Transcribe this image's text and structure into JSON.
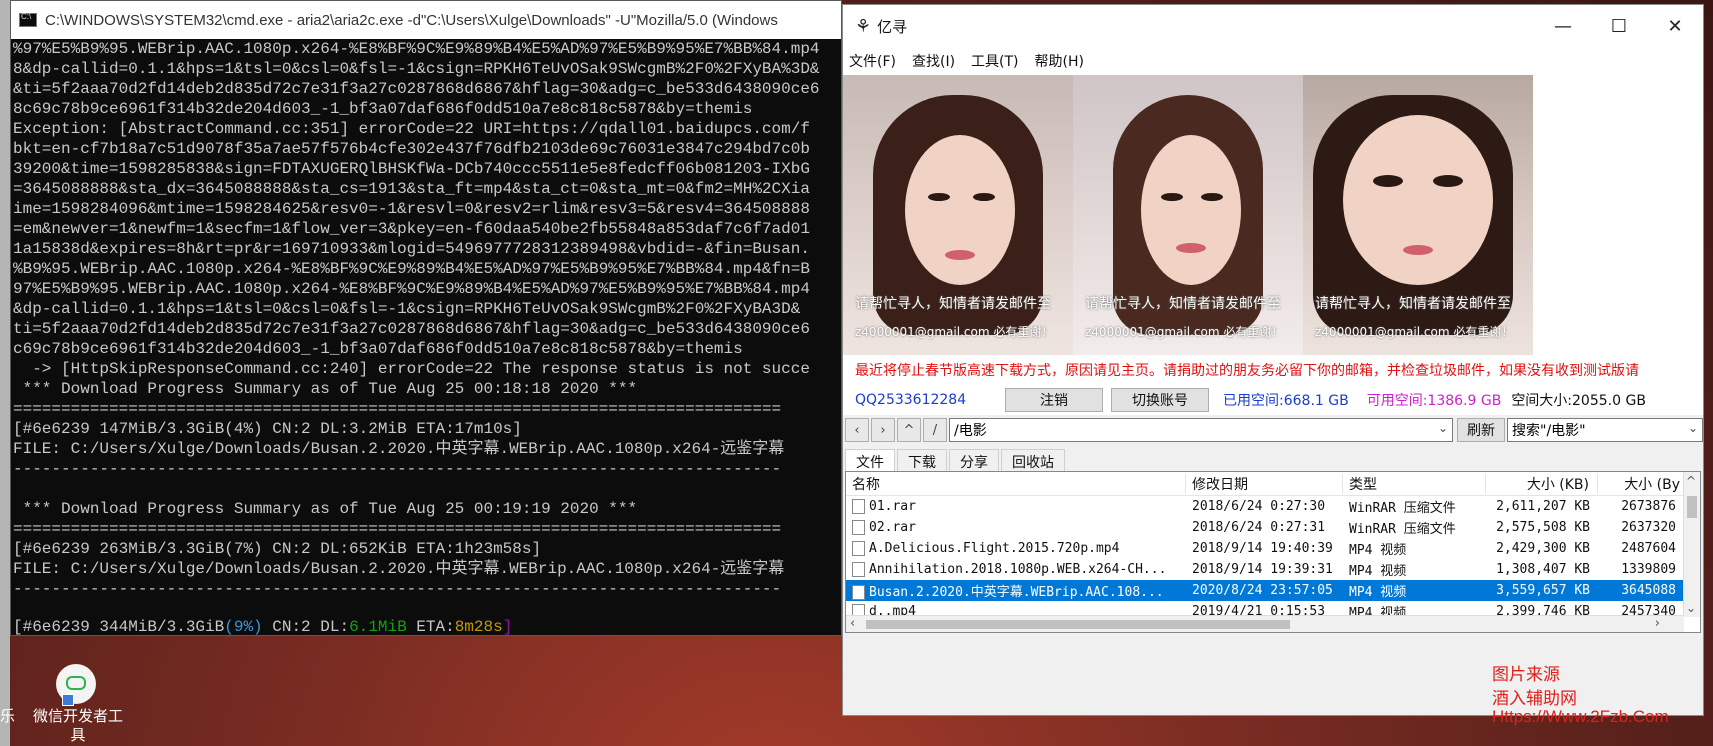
{
  "cmd": {
    "title": "C:\\WINDOWS\\SYSTEM32\\cmd.exe - aria2\\aria2c.exe  -d\"C:\\Users\\Xulge\\Downloads\" -U\"Mozilla/5.0 (Windows",
    "lines": [
      "%97%E5%B9%95.WEBrip.AAC.1080p.x264-%E8%BF%9C%E9%89%B4%E5%AD%97%E5%B9%95%E7%BB%84.mp4",
      "8&dp-callid=0.1.1&hps=1&tsl=0&csl=0&fsl=-1&csign=RPKH6TeUvOSak9SWcgmB%2F0%2FXyBA%3D&",
      "&ti=5f2aaa70d2fd14deb2d835d72c7e31f3a27c0287868d6867&hflag=30&adg=c_be533d6438090ce6",
      "8c69c78b9ce6961f314b32de204d603_-1_bf3a07daf686f0dd510a7e8c818c5878&by=themis",
      "Exception: [AbstractCommand.cc:351] errorCode=22 URI=https://qdall01.baidupcs.com/f",
      "bkt=en-cf7b18a7c51d9078f35a7ae57f576b4cfe302e437f76dfb2103de69c76031e3847c294bd7c0b",
      "39200&time=1598285838&sign=FDTAXUGERQlBHSKfWa-DCb740ccc5511e5e8fedcff06b081203-IXbG",
      "=3645088888&sta_dx=3645088888&sta_cs=1913&sta_ft=mp4&sta_ct=0&sta_mt=0&fm2=MH%2CXia",
      "ime=1598284096&mtime=1598284625&resv0=-1&resvl=0&resv2=rlim&resv3=5&resv4=364508888",
      "=em&newver=1&newfm=1&secfm=1&flow_ver=3&pkey=en-f60daa540be2fb55848a853daf7c6f7ad01",
      "1a15838d&expires=8h&rt=pr&r=169710933&mlogid=5496977728312389498&vbdid=-&fin=Busan.",
      "%B9%95.WEBrip.AAC.1080p.x264-%E8%BF%9C%E9%89%B4%E5%AD%97%E5%B9%95%E7%BB%84.mp4&fn=B",
      "97%E5%B9%95.WEBrip.AAC.1080p.x264-%E8%BF%9C%E9%89%B4%E5%AD%97%E5%B9%95%E7%BB%84.mp4",
      "&dp-callid=0.1.1&hps=1&tsl=0&csl=0&fsl=-1&csign=RPKH6TeUvOSak9SWcgmB%2F0%2FXyBA3D&",
      "ti=5f2aaa70d2fd14deb2d835d72c7e31f3a27c0287868d6867&hflag=30&adg=c_be533d6438090ce6",
      "c69c78b9ce6961f314b32de204d603_-1_bf3a07daf686f0dd510a7e8c818c5878&by=themis",
      "  -> [HttpSkipResponseCommand.cc:240] errorCode=22 The response status is not succe",
      " *** Download Progress Summary as of Tue Aug 25 00:18:18 2020 ***",
      "================================================================================",
      "[#6e6239 147MiB/3.3GiB(4%) CN:2 DL:3.2MiB ETA:17m10s]",
      "FILE: C:/Users/Xulge/Downloads/Busan.2.2020.中英字幕.WEBrip.AAC.1080p.x264-远鉴字幕",
      "--------------------------------------------------------------------------------",
      "",
      " *** Download Progress Summary as of Tue Aug 25 00:19:19 2020 ***",
      "================================================================================",
      "[#6e6239 263MiB/3.3GiB(7%) CN:2 DL:652KiB ETA:1h23m58s]",
      "FILE: C:/Users/Xulge/Downloads/Busan.2.2020.中英字幕.WEBrip.AAC.1080p.x264-远鉴字幕",
      "--------------------------------------------------------------------------------",
      ""
    ],
    "status": {
      "prefix": "[#6e6239 344MiB/3.3GiB",
      "pct": "(9%)",
      "cn": " CN:2 DL:",
      "speed": "6.1MiB",
      "eta_label": " ETA:",
      "eta": "8m28s",
      "close": "]"
    }
  },
  "app": {
    "logo": "⚘",
    "title": "亿寻",
    "win_min": "—",
    "win_max": "☐",
    "win_close": "✕",
    "menu": [
      "文件(F)",
      "查找(I)",
      "工具(T)",
      "帮助(H)"
    ],
    "ads": [
      {
        "caption": "请帮忙寻人，知情者请发邮件至",
        "email": "z4000001@gmail.com 必有重谢！"
      },
      {
        "caption": "请帮忙寻人，知情者请发邮件至",
        "email": "z4000001@gmail.com 必有重谢！"
      },
      {
        "caption": "请帮忙寻人，知情者请发邮件至",
        "email": "z4000001@gmail.com 必有重谢！"
      }
    ],
    "notice": "最近将停止春节版高速下载方式，原因请见主页。请捐助过的朋友务必留下你的邮箱，并检查垃圾邮件，如果没有收到测试版请",
    "qq": "QQ2533612284",
    "logout": "注销",
    "switch_account": "切换账号",
    "used_space": "已用空间:668.1 GB",
    "free_space": "可用空间:1386.9 GB",
    "total_space": "空间大小:2055.0 GB",
    "colors": {
      "used": "#1a3cd0",
      "free": "#d020d0",
      "accent": "#0078d7"
    },
    "nav": {
      "back": "‹",
      "forward": "›",
      "up": "^",
      "root": "/"
    },
    "path": "/电影",
    "refresh": "刷新",
    "search": "搜索\"/电影\"",
    "tabs": [
      "文件",
      "下载",
      "分享",
      "回收站"
    ],
    "columns": [
      "名称",
      "修改日期",
      "类型",
      "大小 (KB)",
      "大小 (By"
    ],
    "files": [
      {
        "name": "01.rar",
        "date": "2018/6/24 0:27:30",
        "type": "WinRAR 压缩文件",
        "kb": "2,611,207 KB",
        "bytes": "2673876"
      },
      {
        "name": "02.rar",
        "date": "2018/6/24 0:27:31",
        "type": "WinRAR 压缩文件",
        "kb": "2,575,508 KB",
        "bytes": "2637320"
      },
      {
        "name": "A.Delicious.Flight.2015.720p.mp4",
        "date": "2018/9/14 19:40:39",
        "type": "MP4 视频",
        "kb": "2,429,300 KB",
        "bytes": "2487604"
      },
      {
        "name": "Annihilation.2018.1080p.WEB.x264-CH...",
        "date": "2018/9/14 19:39:31",
        "type": "MP4 视频",
        "kb": "1,308,407 KB",
        "bytes": "1339809"
      },
      {
        "name": "Busan.2.2020.中英字幕.WEBrip.AAC.108...",
        "date": "2020/8/24 23:57:05",
        "type": "MP4 视频",
        "kb": "3,559,657 KB",
        "bytes": "3645088"
      },
      {
        "name": "d..mp4",
        "date": "2019/4/21 0:15:53",
        "type": "MP4 视频",
        "kb": "2,399,746 KB",
        "bytes": "2457340"
      }
    ]
  },
  "watermark": [
    "图片来源",
    "酒入辅助网",
    "Https://Www.2Fzb.Com"
  ],
  "desktop": {
    "icon_label_1": "微信开发者工",
    "icon_label_2": "具",
    "left_label": "乐"
  }
}
